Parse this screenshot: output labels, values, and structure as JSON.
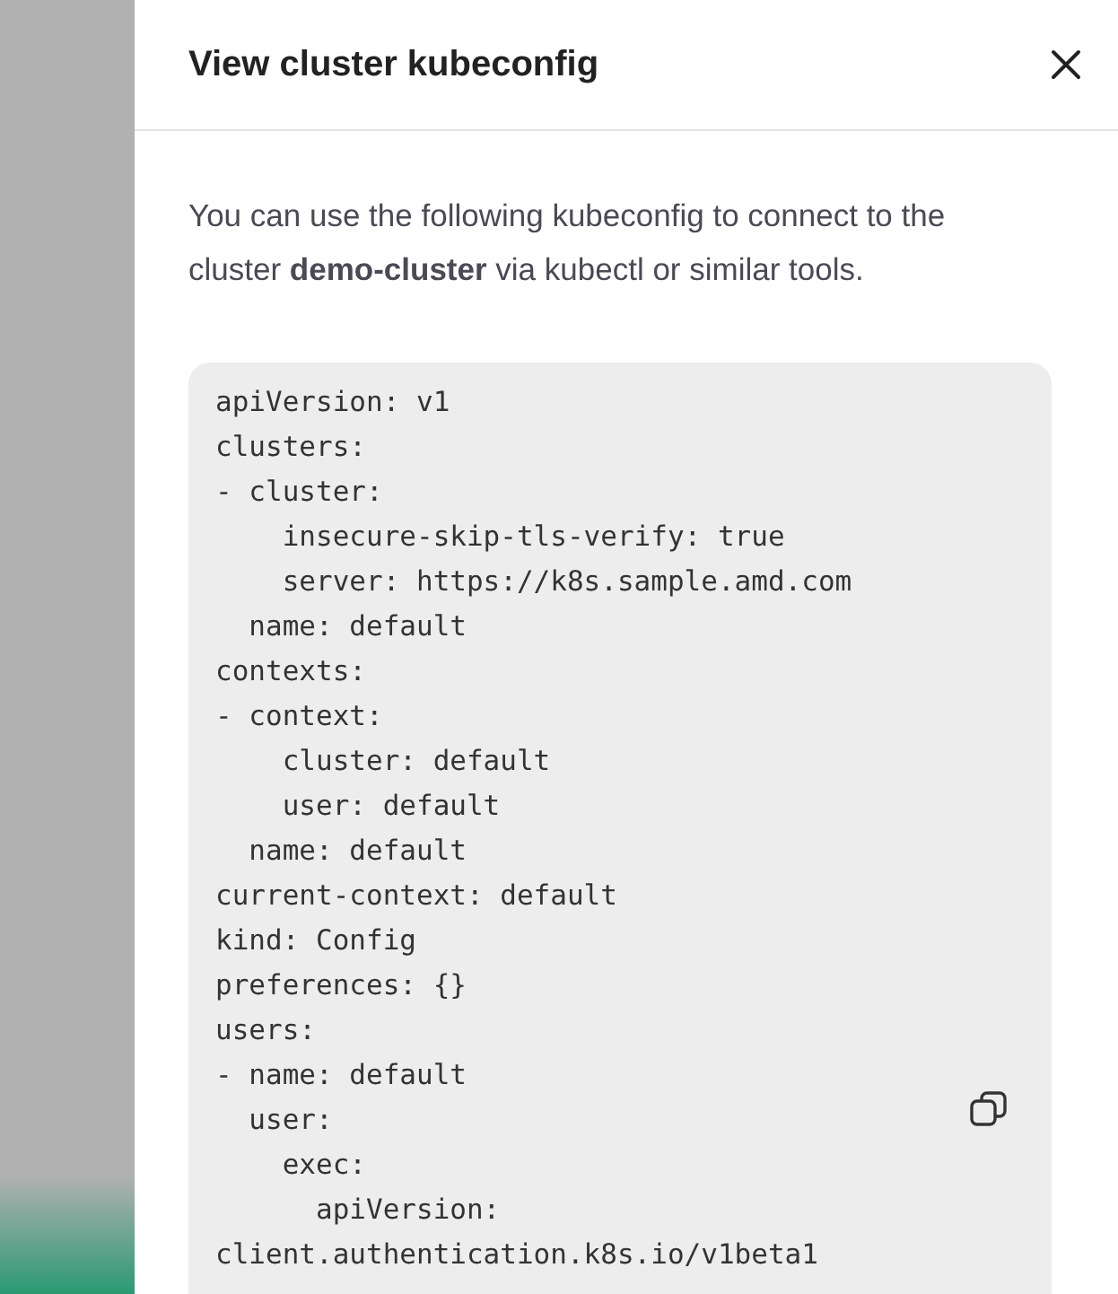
{
  "dialog": {
    "title": "View cluster kubeconfig",
    "description": "You can use the following kubeconfig to connect to the cluster **demo-cluster** via kubectl or similar tools.",
    "kubeconfig_lines": [
      "apiVersion: v1",
      "clusters:",
      "- cluster:",
      "    insecure-skip-tls-verify: true",
      "    server: https://k8s.sample.amd.com",
      "  name: default",
      "contexts:",
      "- context:",
      "    cluster: default",
      "    user: default",
      "  name: default",
      "current-context: default",
      "kind: Config",
      "preferences: {}",
      "users:",
      "- name: default",
      "  user:",
      "    exec:",
      "      apiVersion:",
      "client.authentication.k8s.io/v1beta1"
    ]
  }
}
